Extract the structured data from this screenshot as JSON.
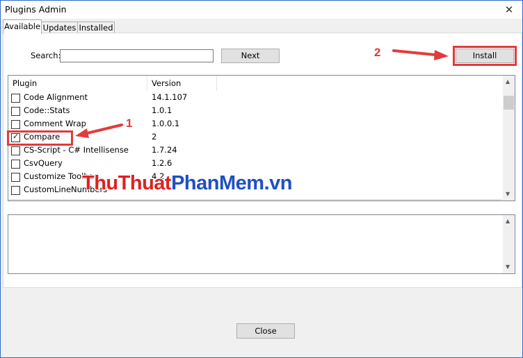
{
  "window": {
    "title": "Plugins Admin",
    "close_glyph": "✕"
  },
  "tabs": [
    {
      "label": "Available",
      "active": true
    },
    {
      "label": "Updates",
      "active": false
    },
    {
      "label": "Installed",
      "active": false
    }
  ],
  "search": {
    "label": "Search:",
    "value": ""
  },
  "buttons": {
    "next": "Next",
    "install": "Install",
    "close": "Close"
  },
  "plugin_list": {
    "columns": [
      "Plugin",
      "Version"
    ],
    "rows": [
      {
        "name": "Code Alignment",
        "version": "14.1.107",
        "checked": false
      },
      {
        "name": "Code::Stats",
        "version": "1.0.1",
        "checked": false
      },
      {
        "name": "Comment Wrap",
        "version": "1.0.0.1",
        "checked": false
      },
      {
        "name": "Compare",
        "version": "2",
        "checked": true
      },
      {
        "name": "CS-Script - C# Intellisense",
        "version": "1.7.24",
        "checked": false
      },
      {
        "name": "CsvQuery",
        "version": "1.2.6",
        "checked": false
      },
      {
        "name": "Customize Toolbar",
        "version": "4.2",
        "checked": false
      },
      {
        "name": "CustomLineNumbers",
        "version": "",
        "checked": false
      }
    ]
  },
  "annotations": {
    "step1": "1",
    "step2": "2",
    "color": "#e23b3b"
  },
  "watermark": {
    "thu": "Thu",
    "thuat": "Thuat",
    "phan": "PhanMem",
    "vn": ".vn"
  },
  "colors": {
    "window_border": "#2b6cc4",
    "highlight": "#e23b3b",
    "wm_red": "#e02020",
    "wm_blue": "#1f4fc4"
  }
}
